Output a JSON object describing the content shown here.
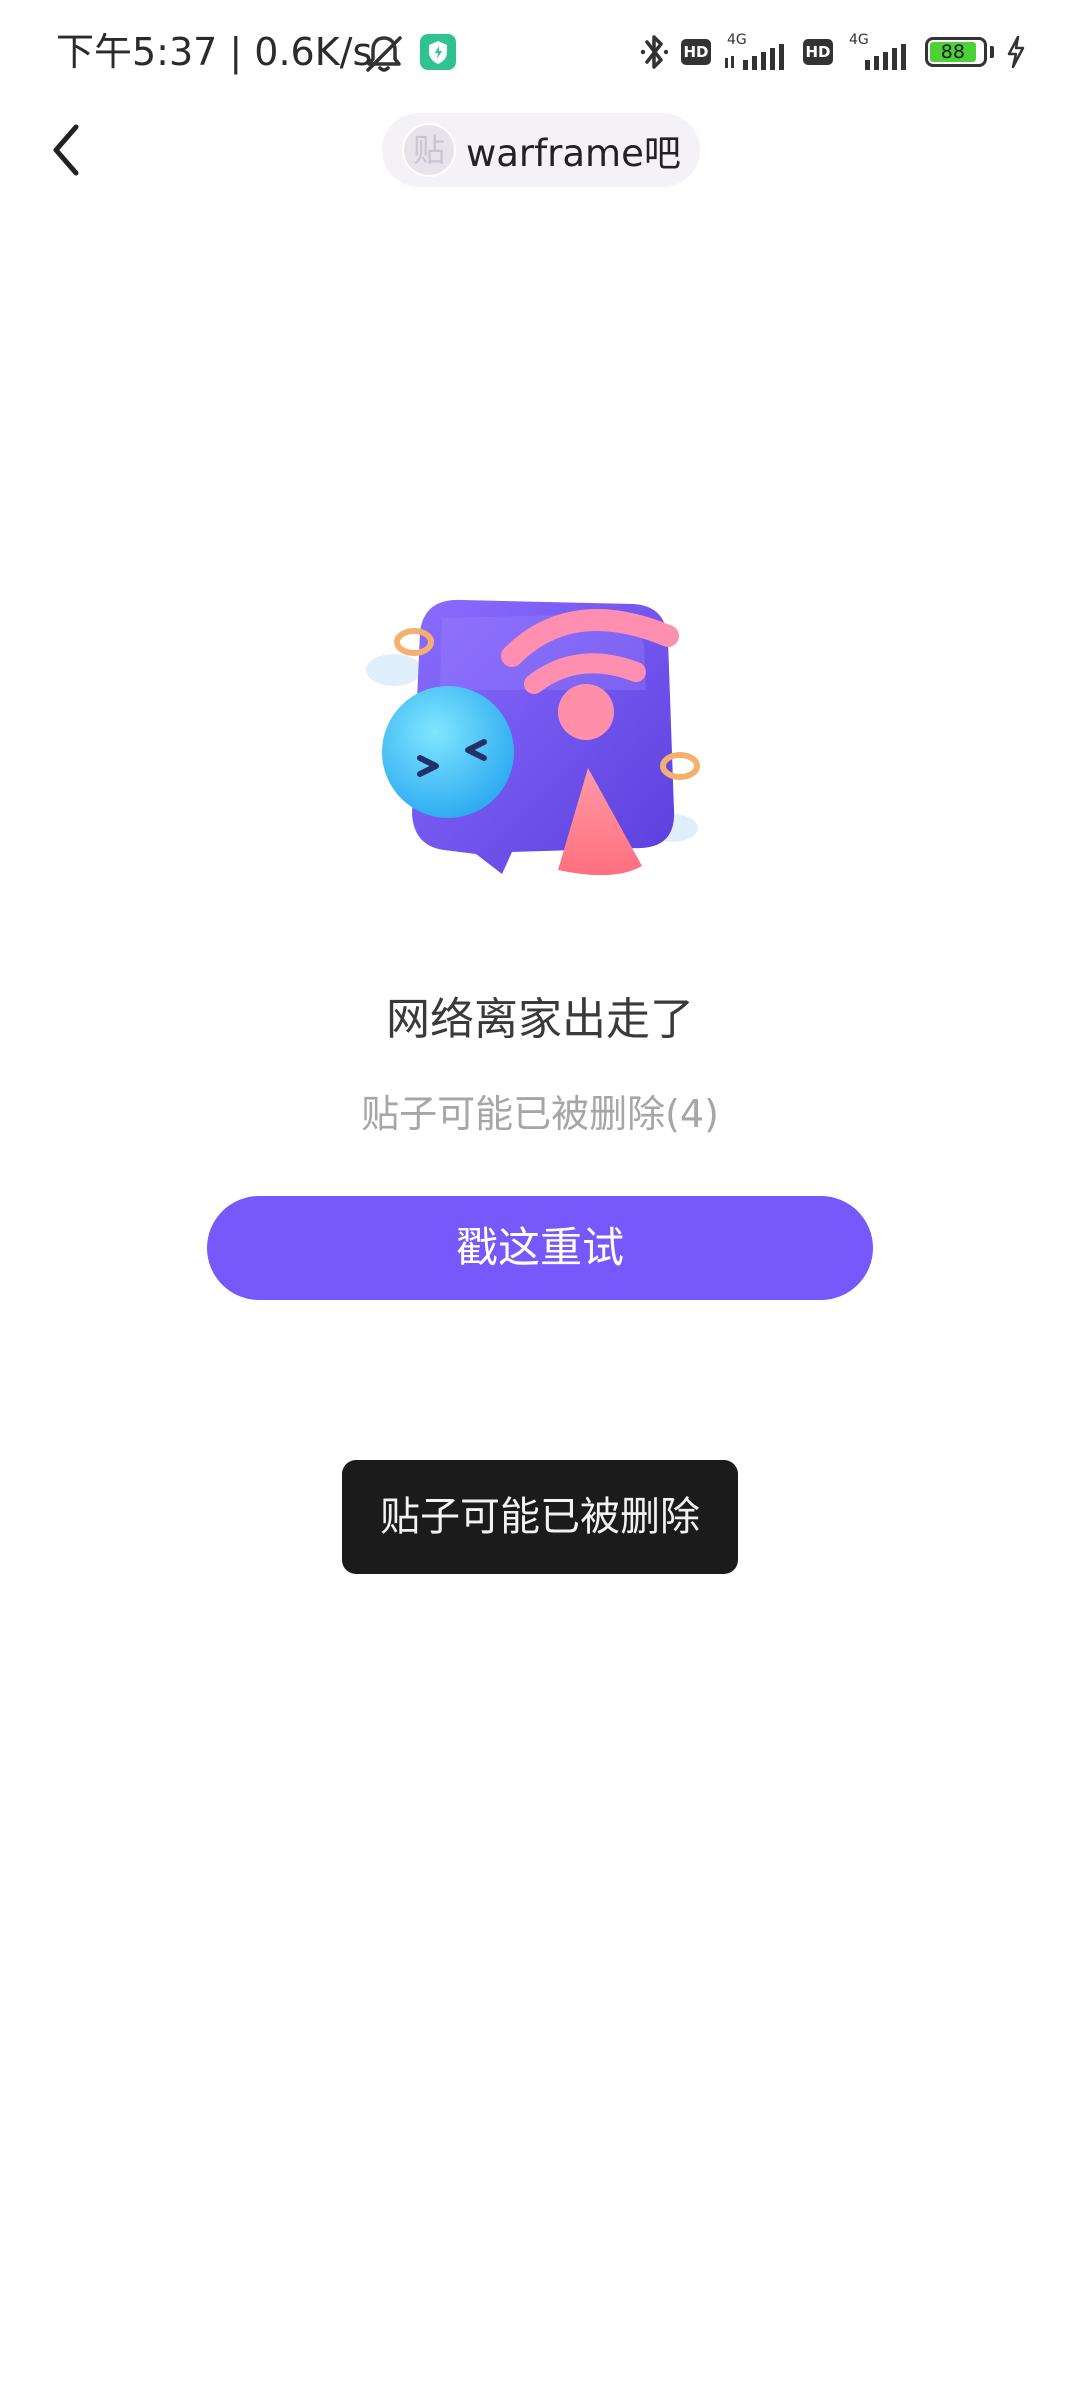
{
  "status_bar": {
    "time_and_speed": "下午5:37 | 0.6K/s",
    "hd_label": "HD",
    "network_label": "4G",
    "battery_level": "88"
  },
  "header": {
    "forum_name": "warframe吧",
    "avatar_glyph": "贴"
  },
  "empty_state": {
    "title": "网络离家出走了",
    "subtitle": "贴子可能已被删除(4)",
    "retry_label": "戳这重试"
  },
  "toast": {
    "message": "贴子可能已被删除"
  },
  "colors": {
    "accent": "#7559fb",
    "toast_bg": "#1b1b1b",
    "battery": "#4cd137"
  }
}
